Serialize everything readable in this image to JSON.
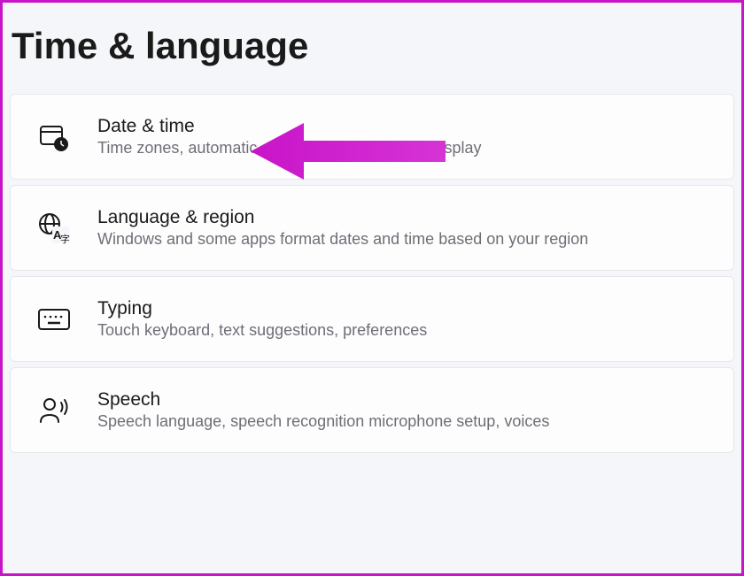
{
  "header": {
    "title": "Time & language"
  },
  "settings": [
    {
      "icon": "calendar-clock-icon",
      "title": "Date & time",
      "subtitle": "Time zones, automatic clock settings, calendar display"
    },
    {
      "icon": "globe-language-icon",
      "title": "Language & region",
      "subtitle": "Windows and some apps format dates and time based on your region"
    },
    {
      "icon": "keyboard-icon",
      "title": "Typing",
      "subtitle": "Touch keyboard, text suggestions, preferences"
    },
    {
      "icon": "speech-icon",
      "title": "Speech",
      "subtitle": "Speech language, speech recognition microphone setup, voices"
    }
  ],
  "annotation": {
    "arrow_color": "#c814c8"
  }
}
